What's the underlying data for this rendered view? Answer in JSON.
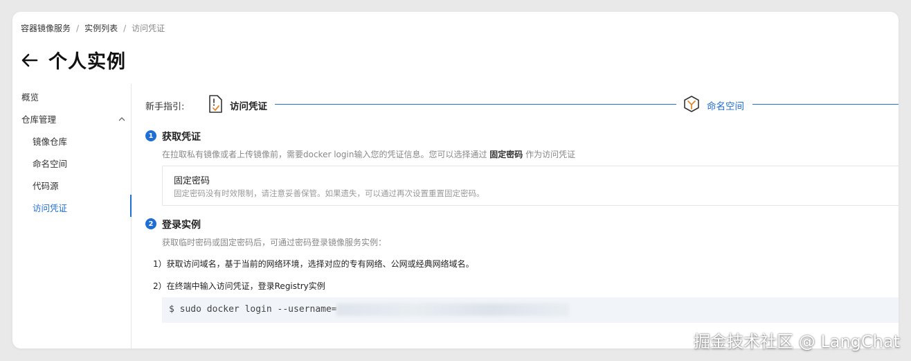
{
  "breadcrumb": {
    "items": [
      "容器镜像服务",
      "实例列表"
    ],
    "current": "访问凭证",
    "separator": "/"
  },
  "header": {
    "title": "个人实例"
  },
  "sidebar": {
    "overview": "概览",
    "repo_group": "仓库管理",
    "subitems": [
      "镜像仓库",
      "命名空间",
      "代码源",
      "访问凭证"
    ],
    "active_index": 3
  },
  "guide": {
    "label": "新手指引:",
    "steps": [
      "访问凭证",
      "命名空间"
    ]
  },
  "step1": {
    "number": "1",
    "title": "获取凭证",
    "desc_prefix": "在拉取私有镜像或者上传镜像前，需要docker login输入您的凭证信息。您可以选择通过 ",
    "desc_highlight": "固定密码",
    "desc_suffix": " 作为访问凭证",
    "box_title": "固定密码",
    "box_desc": "固定密码没有时效限制，请注意妥善保管。如果遗失，可以通过再次设置重置固定密码。"
  },
  "step2": {
    "number": "2",
    "title": "登录实例",
    "desc": "获取临时密码或固定密码后，可通过密码登录镜像服务实例：",
    "line1": "1）获取访问域名，基于当前的网络环境，选择对应的专有网络、公网或经典网络域名。",
    "line2": "2）在终端中输入访问凭证，登录Registry实例",
    "code": "$ sudo docker login --username="
  },
  "watermark": "掘金技术社区 @ LangChat",
  "colors": {
    "accent": "#1f6ed4",
    "code_bg": "#f1f4f8"
  }
}
